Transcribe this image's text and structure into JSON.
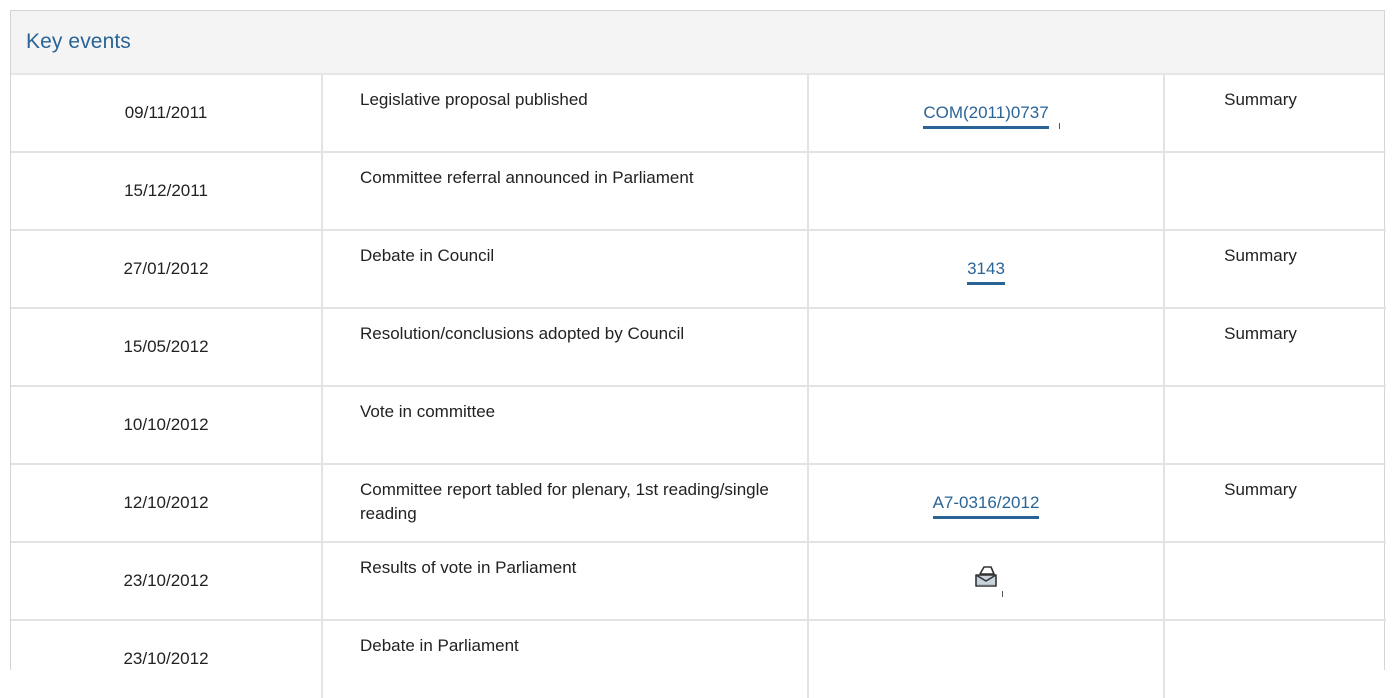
{
  "panel": {
    "title": "Key events"
  },
  "events": [
    {
      "date": "09/11/2011",
      "event": "Legislative proposal published",
      "doc": "COM(2011)0737",
      "summary": "Summary"
    },
    {
      "date": "15/12/2011",
      "event": "Committee referral announced in Parliament",
      "doc": "",
      "summary": ""
    },
    {
      "date": "27/01/2012",
      "event": "Debate in Council",
      "doc": "3143",
      "summary": "Summary"
    },
    {
      "date": "15/05/2012",
      "event": "Resolution/conclusions adopted by Council",
      "doc": "",
      "summary": "Summary"
    },
    {
      "date": "10/10/2012",
      "event": "Vote in committee",
      "doc": "",
      "summary": ""
    },
    {
      "date": "12/10/2012",
      "event": "Committee report tabled for plenary, 1st reading/single reading",
      "doc": "A7-0316/2012",
      "summary": "Summary"
    },
    {
      "date": "23/10/2012",
      "event": "Results of vote in Parliament",
      "doc_icon": "ballot-box-icon",
      "summary": ""
    },
    {
      "date": "23/10/2012",
      "event": "Debate in Parliament",
      "doc": "",
      "summary": ""
    }
  ],
  "colors": {
    "link": "#2a6496",
    "header_bg": "#f4f4f4",
    "border": "#e3e3e3"
  }
}
